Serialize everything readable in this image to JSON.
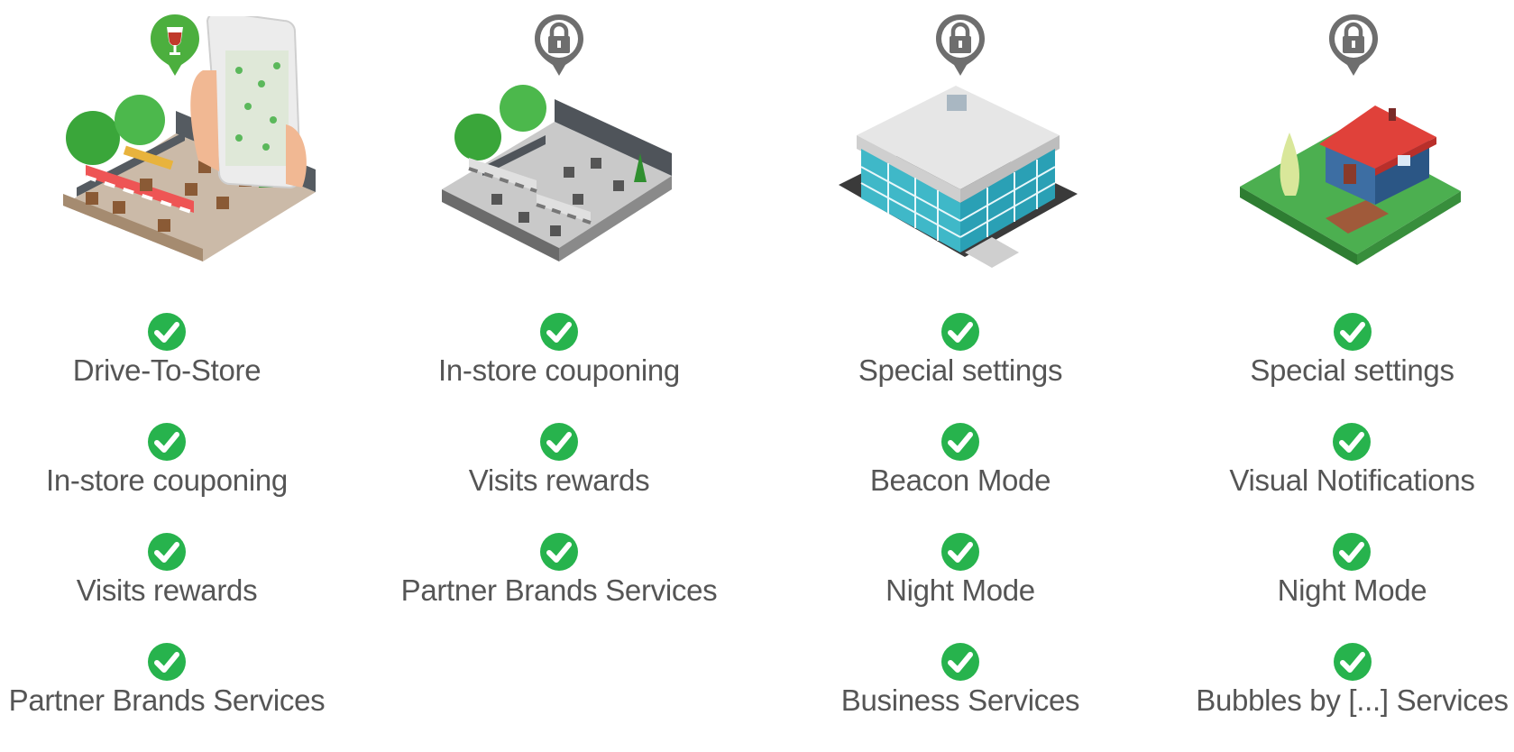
{
  "colors": {
    "check": "#27b34d",
    "lock_pin": "#6e6e6e",
    "wine_pin": "#4caf3e",
    "text": "#555555"
  },
  "columns": [
    {
      "pin_icon": "wine-glass-icon",
      "illustration": "restaurant-with-phone-map",
      "features": [
        "Drive-To-Store",
        "In-store couponing",
        "Visits rewards",
        "Partner Brands Services"
      ]
    },
    {
      "pin_icon": "lock-icon",
      "illustration": "store-interior",
      "features": [
        "In-store couponing",
        "Visits rewards",
        "Partner Brands Services"
      ]
    },
    {
      "pin_icon": "lock-icon",
      "illustration": "office-building",
      "features": [
        "Special settings",
        "Beacon Mode",
        "Night Mode",
        "Business Services"
      ]
    },
    {
      "pin_icon": "lock-icon",
      "illustration": "house-with-garden",
      "features": [
        "Special settings",
        "Visual Notifications",
        "Night Mode",
        "Bubbles by [...] Services"
      ]
    }
  ]
}
